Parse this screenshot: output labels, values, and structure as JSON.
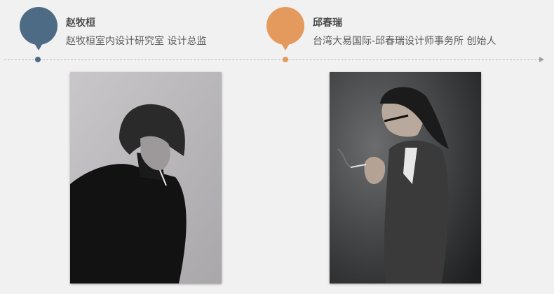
{
  "profiles": [
    {
      "name": "赵牧桓",
      "title": "赵牧桓室内设计研究室  设计总监",
      "accent": "#4e6b86",
      "pin_icon": "map-pin-icon",
      "photo_desc": "grayscale-portrait"
    },
    {
      "name": "邱春瑞",
      "title": "台湾大易国际-邱春瑞设计师事务所 创始人",
      "accent": "#e49a5c",
      "pin_icon": "map-pin-icon",
      "photo_desc": "grayscale-portrait"
    }
  ],
  "timeline": {
    "arrow_icon": "arrow-right-icon"
  }
}
